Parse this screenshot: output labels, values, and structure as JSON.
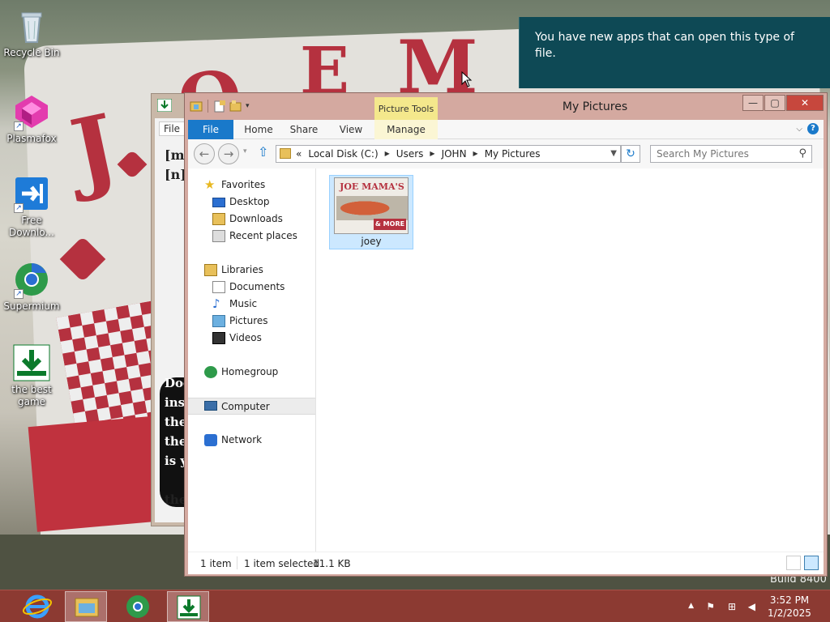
{
  "desktop": {
    "build_label": "Build 8400",
    "icons": [
      {
        "label": "Recycle Bin",
        "icon": "recycle-bin-icon"
      },
      {
        "label": "Plasmafox",
        "icon": "plasmafox-icon"
      },
      {
        "label": "Free Downlo...",
        "icon": "free-download-icon"
      },
      {
        "label": "Supermium",
        "icon": "supermium-icon"
      },
      {
        "label": "the best game",
        "icon": "game-icon"
      }
    ]
  },
  "background_window": {
    "file_tab": "File",
    "lines_top": [
      "[m",
      "[n]"
    ],
    "lines_bottom": [
      "Doo",
      "insi",
      "the",
      "the",
      "is y",
      "the"
    ]
  },
  "explorer": {
    "title": "My Pictures",
    "contextual_tab": "Picture Tools",
    "tabs": [
      "File",
      "Home",
      "Share",
      "View",
      "Manage"
    ],
    "address": {
      "overflow": "«",
      "crumbs": [
        "Local Disk (C:)",
        "Users",
        "JOHN",
        "My Pictures"
      ]
    },
    "search": {
      "placeholder": "Search My Pictures"
    },
    "nav": {
      "favorites": "Favorites",
      "favorites_items": [
        "Desktop",
        "Downloads",
        "Recent places"
      ],
      "libraries": "Libraries",
      "libraries_items": [
        "Documents",
        "Music",
        "Pictures",
        "Videos"
      ],
      "homegroup": "Homegroup",
      "computer": "Computer",
      "network": "Network"
    },
    "files": [
      {
        "name": "joey",
        "thumb_top": "JOE MAMA'S",
        "thumb_bottom": "& MORE"
      }
    ],
    "status": {
      "count": "1 item",
      "selected": "1 item selected",
      "size": "11.1 KB"
    }
  },
  "toast": {
    "message": "You have new apps that can open this type of file."
  },
  "taskbar": {
    "clock_time": "3:52 PM",
    "clock_date": "1/2/2025"
  },
  "colors": {
    "window_frame": "#d4a9a0",
    "file_tab": "#1979ca",
    "toast_bg": "#0e4955",
    "taskbar": "#8c3a32",
    "selection": "#cce8ff"
  }
}
